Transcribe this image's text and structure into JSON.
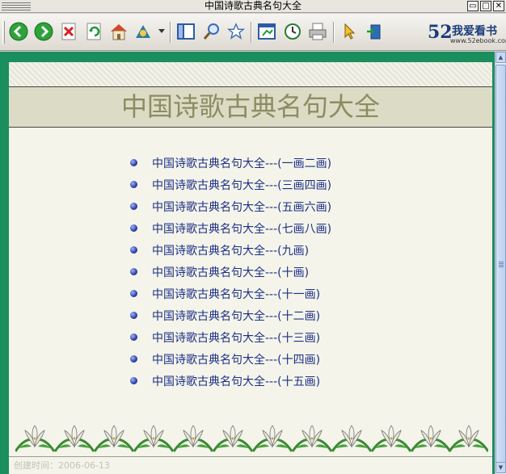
{
  "window": {
    "title": "中国诗歌古典名句大全",
    "controls": [
      "▭",
      "□",
      "✕"
    ]
  },
  "toolbar": {
    "logo_number": "52",
    "logo_text": "我爱看书",
    "logo_url": "www.52ebook.com"
  },
  "page": {
    "heading": "中国诗歌古典名句大全",
    "links": [
      "中国诗歌古典名句大全---(一画二画)",
      "中国诗歌古典名句大全---(三画四画)",
      "中国诗歌古典名句大全---(五画六画)",
      "中国诗歌古典名句大全---(七画八画)",
      "中国诗歌古典名句大全---(九画)",
      "中国诗歌古典名句大全---(十画)",
      "中国诗歌古典名句大全---(十一画)",
      "中国诗歌古典名句大全---(十二画)",
      "中国诗歌古典名句大全---(十三画)",
      "中国诗歌古典名句大全---(十四画)",
      "中国诗歌古典名句大全---(十五画)"
    ],
    "footer": "创建时间：2006-06-13"
  },
  "colors": {
    "frame": "#1b8e5e",
    "page_bg": "#f4f4ea",
    "heading": "#8c8c62",
    "link": "#1d2f86"
  }
}
